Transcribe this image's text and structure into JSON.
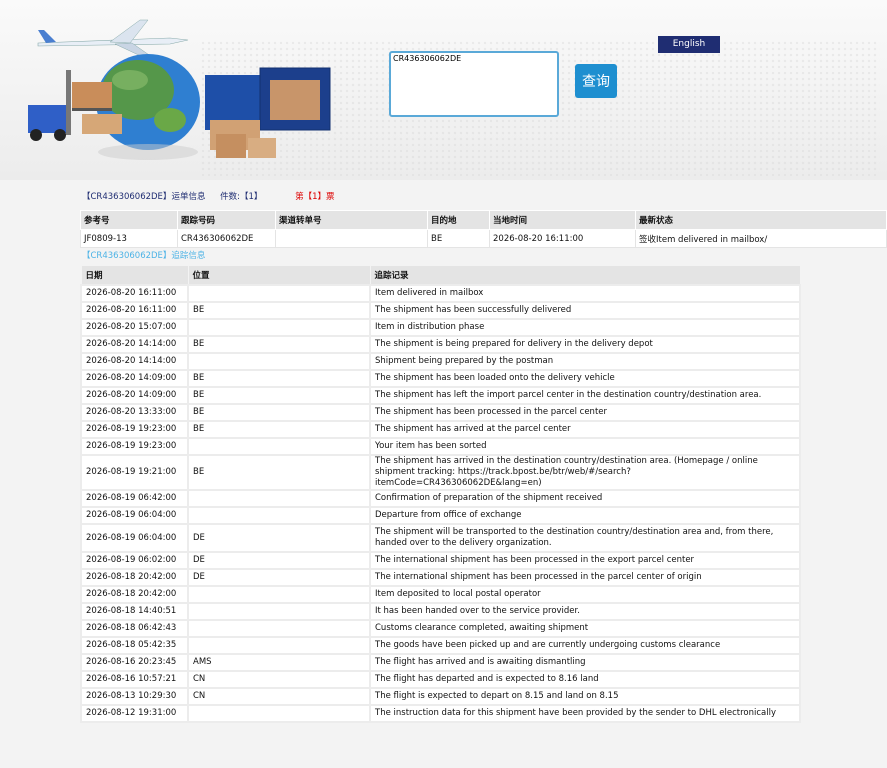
{
  "search": {
    "value": "CR436306062DE",
    "button_label": "查询"
  },
  "lang_label": "English",
  "info": {
    "tracking_ref": "【CR436306062DE】",
    "waybill_label": "运单信息",
    "count_label": "件数:【1】",
    "ticket_label": "第【1】票"
  },
  "summary": {
    "headers": [
      "参考号",
      "跟踪号码",
      "渠道转单号",
      "目的地",
      "当地时间",
      "最新状态"
    ],
    "row": [
      "JF0809-13",
      "CR436306062DE",
      "",
      "BE",
      "2026-08-20 16:11:00",
      "签收Item delivered in mailbox/"
    ]
  },
  "track_title": "【CR436306062DE】追踪信息",
  "tracking": {
    "headers": [
      "日期",
      "位置",
      "追踪记录"
    ],
    "rows": [
      [
        "2026-08-20 16:11:00",
        "",
        "Item delivered in mailbox"
      ],
      [
        "2026-08-20 16:11:00",
        "BE",
        "The shipment has been successfully delivered"
      ],
      [
        "2026-08-20 15:07:00",
        "",
        "Item in distribution phase"
      ],
      [
        "2026-08-20 14:14:00",
        "BE",
        "The shipment is being prepared for delivery in the delivery depot"
      ],
      [
        "2026-08-20 14:14:00",
        "",
        "Shipment being prepared by the postman"
      ],
      [
        "2026-08-20 14:09:00",
        "BE",
        "The shipment has been loaded onto the delivery vehicle"
      ],
      [
        "2026-08-20 14:09:00",
        "BE",
        "The shipment has left the import parcel center in the destination country/destination area."
      ],
      [
        "2026-08-20 13:33:00",
        "BE",
        "The shipment has been processed in the parcel center"
      ],
      [
        "2026-08-19 19:23:00",
        "BE",
        "The shipment has arrived at the parcel center"
      ],
      [
        "2026-08-19 19:23:00",
        "",
        "Your item has been sorted"
      ],
      [
        "2026-08-19 19:21:00",
        "BE",
        "The shipment has arrived in the destination country/destination area. (Homepage / online shipment tracking: https://track.bpost.be/btr/web/#/search?itemCode=CR436306062DE&lang=en)"
      ],
      [
        "2026-08-19 06:42:00",
        "",
        "Confirmation of preparation of the shipment received"
      ],
      [
        "2026-08-19 06:04:00",
        "",
        "Departure from office of exchange"
      ],
      [
        "2026-08-19 06:04:00",
        "DE",
        "The shipment will be transported to the destination country/destination area and, from there, handed over to the delivery organization."
      ],
      [
        "2026-08-19 06:02:00",
        "DE",
        "The international shipment has been processed in the export parcel center"
      ],
      [
        "2026-08-18 20:42:00",
        "DE",
        "The international shipment has been processed in the parcel center of origin"
      ],
      [
        "2026-08-18 20:42:00",
        "",
        "Item deposited to local postal operator"
      ],
      [
        "2026-08-18 14:40:51",
        "",
        "It has been handed over to the service provider."
      ],
      [
        "2026-08-18 06:42:43",
        "",
        "Customs clearance completed, awaiting shipment"
      ],
      [
        "2026-08-18 05:42:35",
        "",
        "The goods have been picked up and are currently undergoing customs clearance"
      ],
      [
        "2026-08-16 20:23:45",
        "AMS",
        "The flight has arrived and is awaiting dismantling"
      ],
      [
        "2026-08-16 10:57:21",
        "CN",
        "The flight has departed and is expected to 8.16 land"
      ],
      [
        "2026-08-13 10:29:30",
        "CN",
        "The flight is expected to depart on 8.15 and land on 8.15"
      ],
      [
        "2026-08-12 19:31:00",
        "",
        "The instruction data for this shipment have been provided by the sender to DHL electronically"
      ]
    ]
  }
}
